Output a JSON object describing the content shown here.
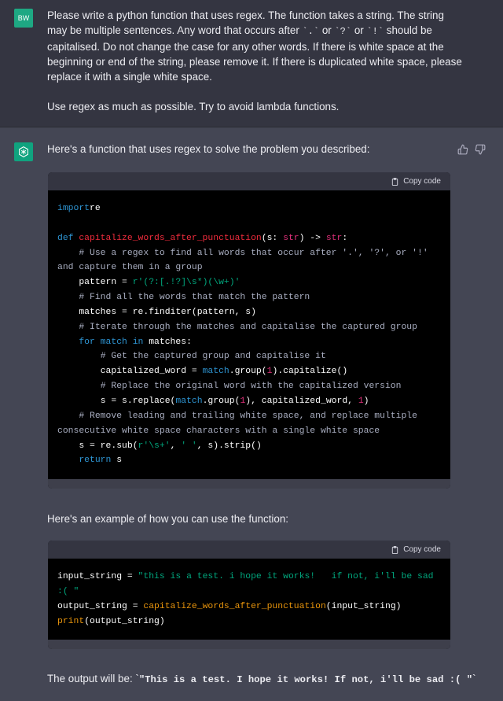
{
  "user": {
    "avatar_initials": "BW",
    "para1": "Please write a python function that uses regex. The function takes a string. The string may be multiple sentences. Any word that occurs after `.` or `?` or `!` should be capitalised. Do not change the case for any other words. If there is white space at the beginning or end of the string, please remove it. If there is duplicated white space, please replace it with a single white space.",
    "para2": "Use regex as much as possible. Try to avoid lambda functions."
  },
  "assistant": {
    "intro": "Here's a function that uses regex to solve the problem you described:",
    "mid": "Here's an example of how you can use the function:",
    "out_prefix": "The output will be: `",
    "out_code": "\"This is a test. I hope it works! If not, i'll be sad :( \"",
    "out_suffix": "`"
  },
  "copy_label": "Copy code",
  "icons": {
    "thumbs_up": "thumbs-up-icon",
    "thumbs_down": "thumbs-down-icon",
    "clipboard": "clipboard-icon",
    "logo": "openai-logo-icon"
  },
  "colors": {
    "user_bg": "#343541",
    "assistant_bg": "#444654",
    "avatar_user": "#1ea883",
    "avatar_bot": "#10a37f",
    "code_bg": "#000000"
  },
  "code1": [
    [
      [
        "kw",
        "import"
      ],
      [
        "",
        "re"
      ]
    ],
    [],
    [
      [
        "kw",
        "def "
      ],
      [
        "fn",
        "capitalize_words_after_punctuation"
      ],
      [
        "",
        "(s: "
      ],
      [
        "ty",
        "str"
      ],
      [
        "",
        ") -> "
      ],
      [
        "ty",
        "str"
      ],
      [
        "",
        ":"
      ]
    ],
    [
      [
        "cm",
        "    # Use a regex to find all words that occur after '.', '?', or '!' and capture them in a group"
      ]
    ],
    [
      [
        "",
        "    pattern = "
      ],
      [
        "st",
        "r'(?:[.!?]\\s*)(\\w+)'"
      ]
    ],
    [
      [
        "cm",
        "    # Find all the words that match the pattern"
      ]
    ],
    [
      [
        "",
        "    matches = re.finditer(pattern, s)"
      ]
    ],
    [
      [
        "cm",
        "    # Iterate through the matches and capitalise the captured group"
      ]
    ],
    [
      [
        "kw",
        "    for "
      ],
      [
        "mt",
        "match"
      ],
      [
        "kw",
        " in "
      ],
      [
        "",
        "matches:"
      ]
    ],
    [
      [
        "cm",
        "        # Get the captured group and capitalise it"
      ]
    ],
    [
      [
        "",
        "        capitalized_word = "
      ],
      [
        "mt",
        "match"
      ],
      [
        "",
        ".group("
      ],
      [
        "nm",
        "1"
      ],
      [
        "",
        ").capitalize()"
      ]
    ],
    [
      [
        "cm",
        "        # Replace the original word with the capitalized version"
      ]
    ],
    [
      [
        "",
        "        s = s.replace("
      ],
      [
        "mt",
        "match"
      ],
      [
        "",
        ".group("
      ],
      [
        "nm",
        "1"
      ],
      [
        "",
        "), capitalized_word, "
      ],
      [
        "nm",
        "1"
      ],
      [
        "",
        ")"
      ]
    ],
    [
      [
        "cm",
        "    # Remove leading and trailing white space, and replace multiple consecutive white space characters with a single white space"
      ]
    ],
    [
      [
        "",
        "    s = re.sub("
      ],
      [
        "st",
        "r'\\s+'"
      ],
      [
        "",
        ", "
      ],
      [
        "st",
        "' '"
      ],
      [
        "",
        ", s).strip()"
      ]
    ],
    [
      [
        "kw",
        "    return "
      ],
      [
        "",
        "s"
      ]
    ]
  ],
  "code2": [
    [
      [
        "",
        "input_string = "
      ],
      [
        "st",
        "\"this is a test. i hope it works!   if not, i'll be sad :( \""
      ]
    ],
    [
      [
        "",
        "output_string = "
      ],
      [
        "call",
        "capitalize_words_after_punctuation"
      ],
      [
        "",
        "(input_string)"
      ]
    ],
    [
      [
        "call",
        "print"
      ],
      [
        "",
        "(output_string)"
      ]
    ]
  ]
}
